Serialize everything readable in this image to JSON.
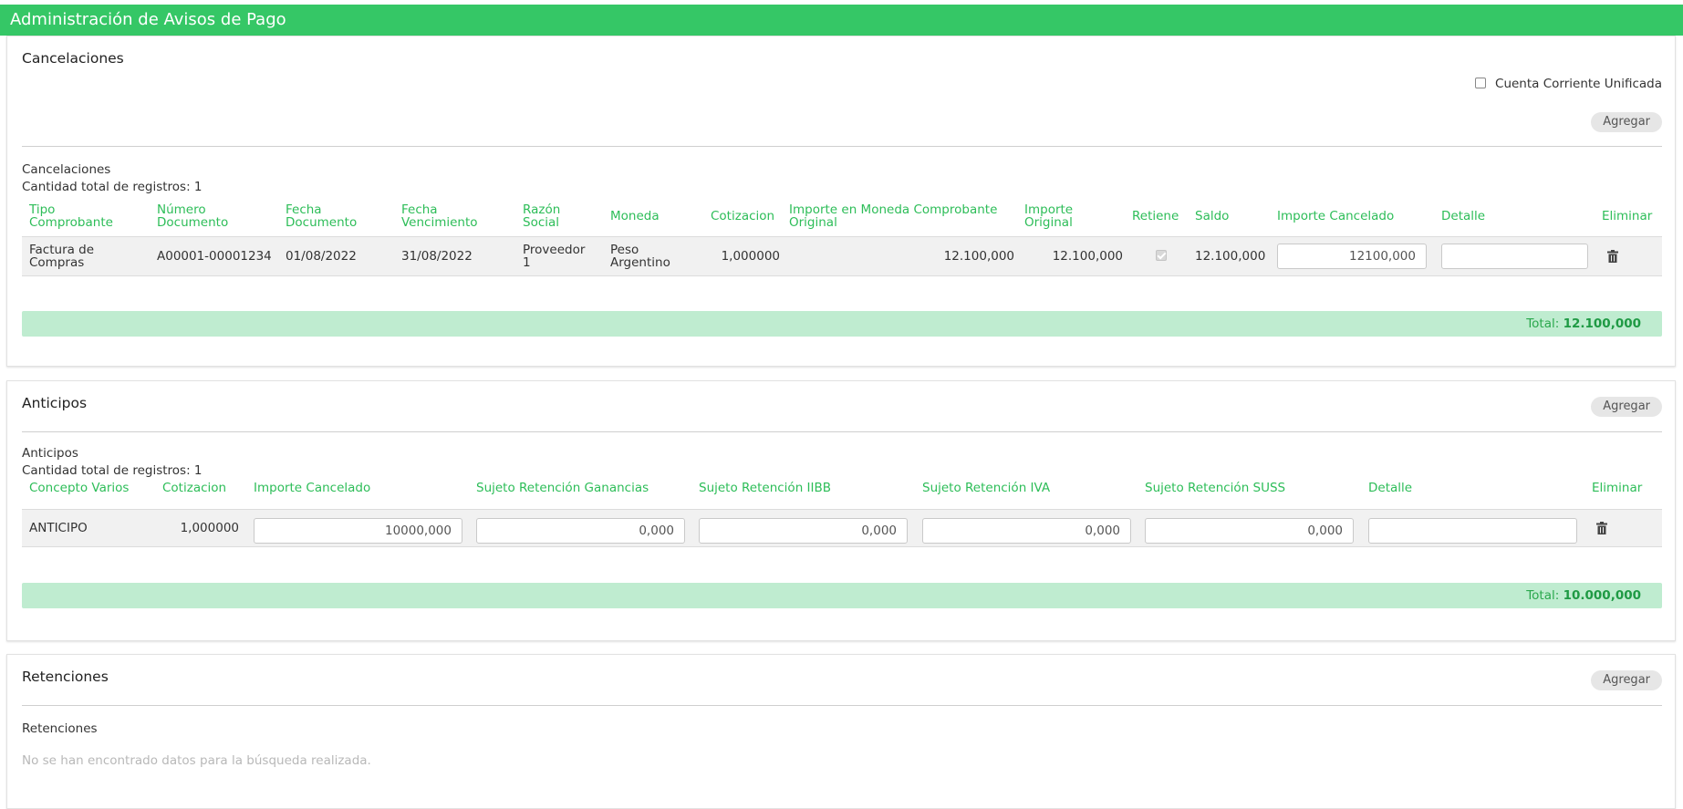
{
  "app_title": "Administración de Avisos de Pago",
  "cancelaciones": {
    "panel_title": "Cancelaciones",
    "unified_account_label": "Cuenta Corriente Unificada",
    "unified_account_checked": false,
    "add_label": "Agregar",
    "list_title": "Cancelaciones",
    "count_text": "Cantidad total de registros: 1",
    "headers": {
      "tipo": "Tipo\nComprobante",
      "numero": "Número\nDocumento",
      "fecha_doc": "Fecha\nDocumento",
      "fecha_venc": "Fecha\nVencimiento",
      "razon": "Razón\nSocial",
      "moneda": "Moneda",
      "cotizacion": "Cotizacion",
      "importe_moneda": "Importe en Moneda Comprobante\nOriginal",
      "importe_original": "Importe\nOriginal",
      "retiene": "Retiene",
      "saldo": "Saldo",
      "importe_cancelado": "Importe Cancelado",
      "detalle": "Detalle",
      "eliminar": "Eliminar"
    },
    "row": {
      "tipo": "Factura de\nCompras",
      "numero": "A00001-00001234",
      "fecha_doc": "01/08/2022",
      "fecha_venc": "31/08/2022",
      "razon": "Proveedor\n1",
      "moneda": "Peso\nArgentino",
      "cotizacion": "1,000000",
      "importe_moneda": "12.100,000",
      "importe_original": "12.100,000",
      "retiene_checked": true,
      "saldo": "12.100,000",
      "importe_cancelado": "12100,000",
      "detalle": ""
    },
    "total_label": "Total: ",
    "total_value": "12.100,000"
  },
  "anticipos": {
    "panel_title": "Anticipos",
    "add_label": "Agregar",
    "list_title": "Anticipos",
    "count_text": "Cantidad total de registros: 1",
    "headers": {
      "concepto": "Concepto Varios",
      "cotizacion": "Cotizacion",
      "importe_cancelado": "Importe Cancelado",
      "ret_ganancias": "Sujeto Retención Ganancias",
      "ret_iibb": "Sujeto Retención IIBB",
      "ret_iva": "Sujeto Retención IVA",
      "ret_suss": "Sujeto Retención SUSS",
      "detalle": "Detalle",
      "eliminar": "Eliminar"
    },
    "row": {
      "concepto": "ANTICIPO",
      "cotizacion": "1,000000",
      "importe_cancelado": "10000,000",
      "ret_ganancias": "0,000",
      "ret_iibb": "0,000",
      "ret_iva": "0,000",
      "ret_suss": "0,000",
      "detalle": ""
    },
    "total_label": "Total: ",
    "total_value": "10.000,000"
  },
  "retenciones": {
    "panel_title": "Retenciones",
    "add_label": "Agregar",
    "list_title": "Retenciones",
    "empty_text": "No se han encontrado datos para la búsqueda realizada."
  },
  "colors": {
    "brand_green": "#35c766",
    "header_green": "#2dbd58",
    "total_bar": "#bfecd0"
  }
}
